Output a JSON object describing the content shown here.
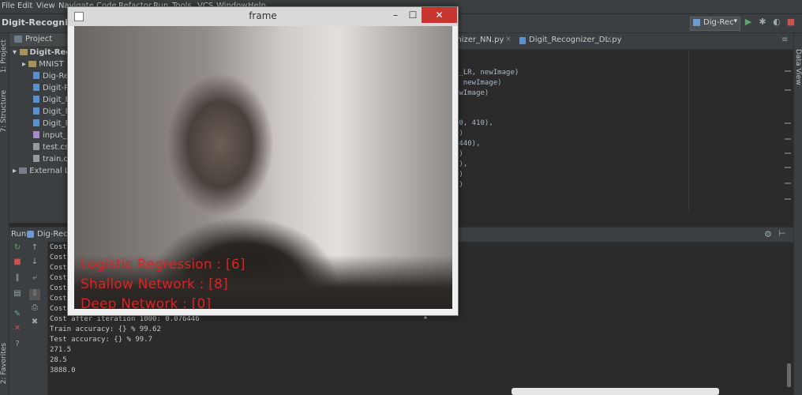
{
  "menu": [
    "File",
    "Edit",
    "View",
    "Navigate",
    "Code",
    "Refactor",
    "Run",
    "Tools",
    "VCS",
    "Window",
    "Help"
  ],
  "nav": {
    "breadcrumb": "Digit-Recognizer",
    "run_config": "Dig-Rec"
  },
  "left_tools": {
    "project": "1: Project",
    "structure": "7: Structure",
    "favorites": "2: Favorites"
  },
  "right_tools": {
    "data_view": "Data View"
  },
  "project": {
    "header": "Project",
    "root": "Digit-Reco",
    "items": [
      "MNIST",
      "Dig-Rec",
      "Digit-Re",
      "Digit_Re",
      "Digit_Re",
      "Digit_Re",
      "input_d",
      "test.csv",
      "train.csv",
      "External Lib"
    ]
  },
  "editor": {
    "tabs": [
      "gnizer_NN.py",
      "Digit_Recognizer_DL.py"
    ],
    "code_lines": [
      "b_LR, newImage)",
      ", newImage)",
      "ewImage)",
      "",
      "",
      "10, 410),",
      "0)",
      ",440),",
      "0)",
      "0),",
      "0)",
      "0)"
    ]
  },
  "run": {
    "title": "Run",
    "config": "Dig-Rec",
    "console_lines": [
      "Cost",
      "Cost",
      "Cost",
      "Cost",
      "Cost",
      "Cost",
      "Cost",
      "Cost after iteration 1000: 0.076446",
      "Train accuracy: {} % 99.62",
      "Test accuracy: {} % 99.7",
      "271.5",
      "28.5",
      "3888.0"
    ]
  },
  "frame": {
    "title": "frame",
    "overlay": [
      "Logistic Regression : [6]",
      "Shallow Network :  [8]",
      "Deep Network :  [0]"
    ]
  },
  "colors": {
    "overlay_text": "#e12020",
    "close_button": "#c7352e",
    "ide_bg": "#2b2b2b"
  }
}
